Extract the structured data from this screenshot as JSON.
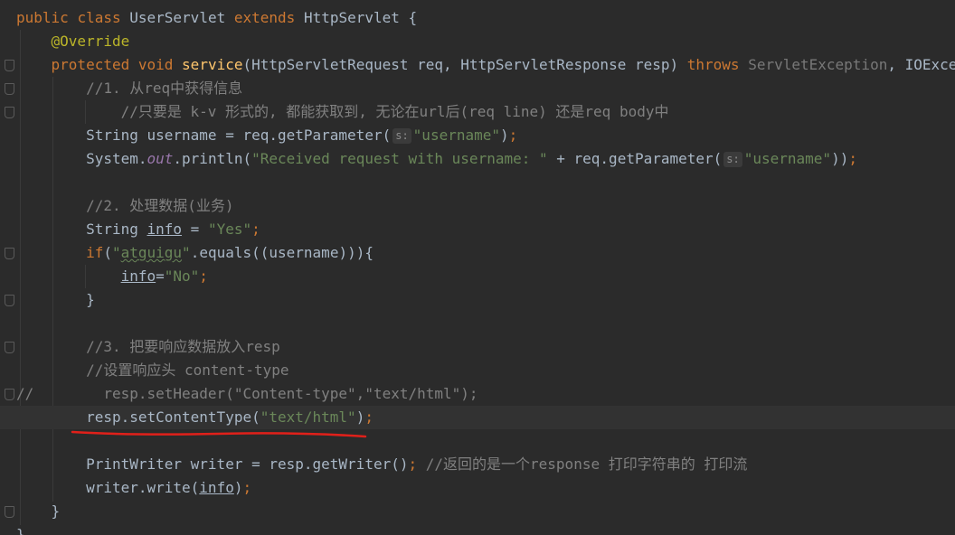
{
  "code": {
    "l1_public": "public",
    "l1_class": "class",
    "l1_name": "UserServlet",
    "l1_extends": "extends",
    "l1_parent": "HttpServlet",
    "l1_brace": "{",
    "l2_override": "@Override",
    "l3_protected": "protected",
    "l3_void": "void",
    "l3_method": "service",
    "l3_params": "(HttpServletRequest req, HttpServletResponse resp) ",
    "l3_throws": "throws",
    "l3_ex1": "ServletException",
    "l3_rest": ", IOException {",
    "l4_comment": "//1. 从req中获得信息",
    "l5_comment": "//只要是 k-v 形式的, 都能获取到, 无论在url后(req line) 还是req body中",
    "l6_a": "String username = req.getParameter(",
    "l6_hint": "s:",
    "l6_str": "\"username\"",
    "l6_b": ")",
    "l6_semi": ";",
    "l7_a": "System.",
    "l7_out": "out",
    "l7_b": ".println(",
    "l7_str": "\"Received request with username: \"",
    "l7_c": " + req.getParameter(",
    "l7_hint": "s:",
    "l7_str2": "\"username\"",
    "l7_d": "))",
    "l7_semi": ";",
    "l9_comment": "//2. 处理数据(业务)",
    "l10_a": "String ",
    "l10_var": "info",
    "l10_b": " = ",
    "l10_str": "\"Yes\"",
    "l10_semi": ";",
    "l11_if": "if",
    "l11_a": "(",
    "l11_q1": "\"",
    "l11_word": "atguigu",
    "l11_q2": "\"",
    "l11_b": ".equals((username))){",
    "l12_var": "info",
    "l12_a": "=",
    "l12_str": "\"No\"",
    "l12_semi": ";",
    "l13_brace": "}",
    "l15_comment": "//3. 把要响应数据放入resp",
    "l16_comment": "//设置响应头 content-type",
    "l17_slashes": "//",
    "l17_code": "        resp.setHeader(\"Content-type\",\"text/html\");",
    "l18_a": "resp.setContentType(",
    "l18_str": "\"text/html\"",
    "l18_b": ")",
    "l18_semi": ";",
    "l20_a": "PrintWriter writer = resp.getWriter()",
    "l20_semi": ";",
    "l20_comment": " //返回的是一个response 打印字符串的 打印流",
    "l21_a": "writer.write(",
    "l21_var": "info",
    "l21_b": ")",
    "l21_semi": ";",
    "l22_brace": "}",
    "l23_brace": "}"
  },
  "colors": {
    "background": "#2b2b2b",
    "keyword": "#cc7832",
    "annotation": "#bbb529",
    "method": "#ffc66d",
    "string": "#6a8759",
    "comment": "#808080",
    "underline_mark": "#e0201a"
  },
  "icons": [
    "fold-marker-icon"
  ]
}
